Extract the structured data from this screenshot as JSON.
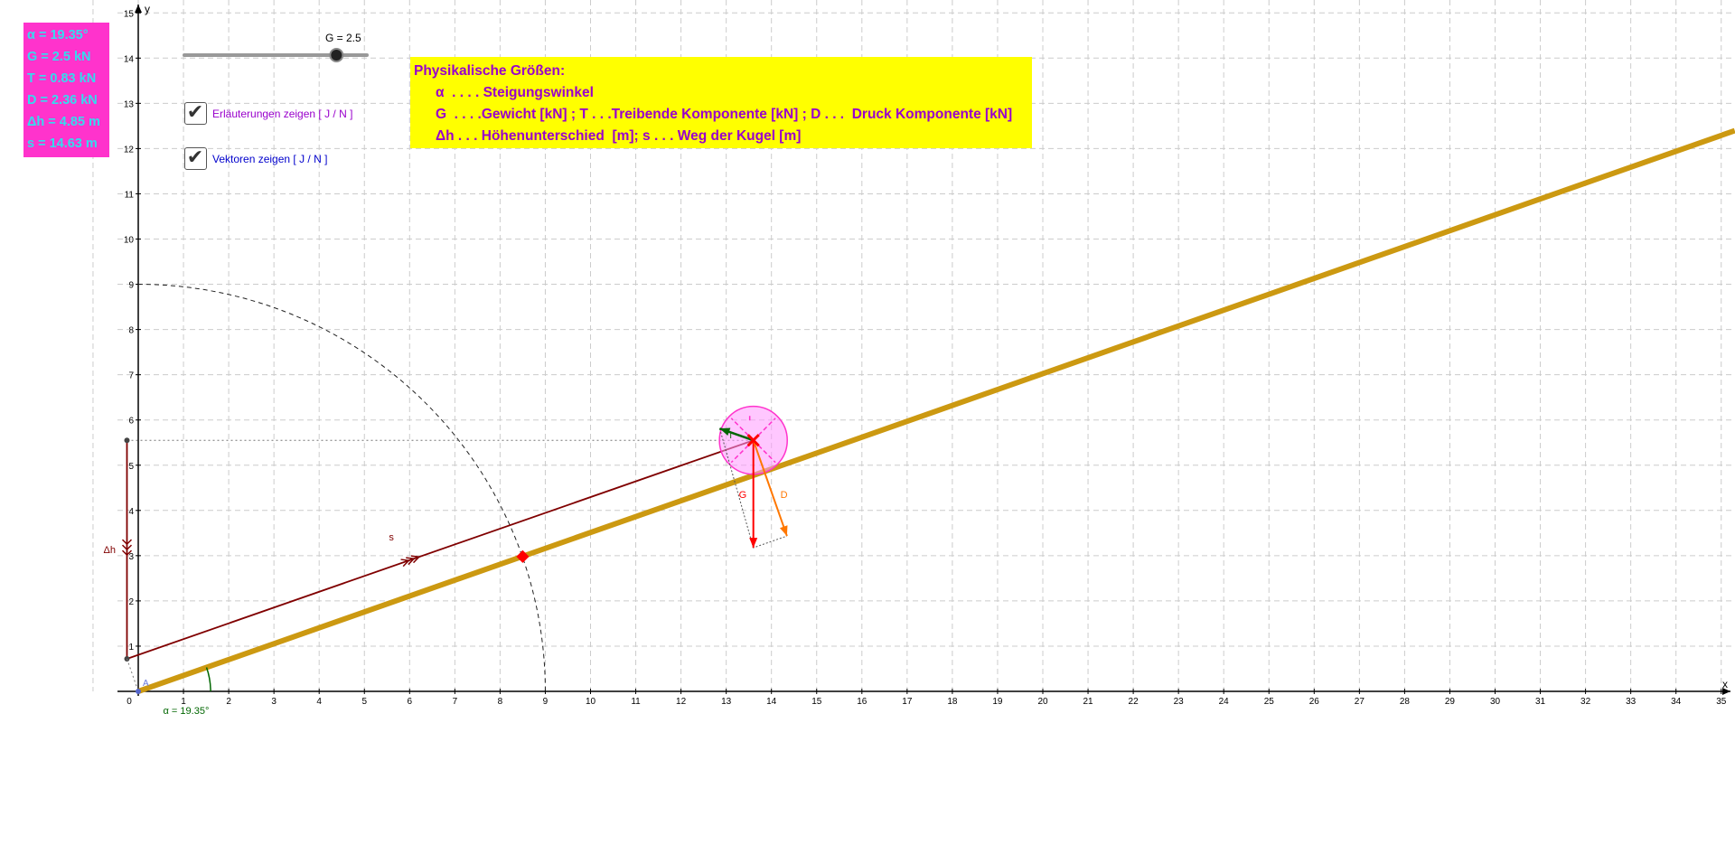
{
  "info": {
    "alpha": "α = 19.35°",
    "g": "G = 2.5 kN",
    "t": "T = 0.83 kN",
    "d": "D = 2.36 kN",
    "dh": "Δh = 4.85 m",
    "s": "s = 14.63 m"
  },
  "slider": {
    "label": "G = 2.5",
    "value": 2.5,
    "min": 0,
    "max": 3
  },
  "checkboxes": {
    "explain": {
      "label": "Erläuterungen zeigen [ J / N ]",
      "checked": true,
      "color": "#9900cc"
    },
    "vectors": {
      "label": "Vektoren zeigen [ J / N ]",
      "checked": true,
      "color": "#0000cc"
    }
  },
  "legend": {
    "title": "Physikalische Größen:",
    "line1": "α  . . . . Steigungswinkel",
    "line2": "G  . . . .Gewicht [kN] ; T . . .Treibende Komponente [kN] ; D . . .  Druck Komponente [kN]",
    "line3": "Δh . . . Höhenunterschied  [m]; s . . . Weg der Kugel [m]"
  },
  "axes": {
    "x_label": "x",
    "y_label": "y",
    "x_range": [
      0,
      35
    ],
    "y_range": [
      0,
      15
    ],
    "origin_label": "0",
    "x_ticks": [
      "1",
      "2",
      "3",
      "4",
      "5",
      "6",
      "7",
      "8",
      "9",
      "10",
      "11",
      "12",
      "13",
      "14",
      "15",
      "16",
      "17",
      "18",
      "19",
      "20",
      "21",
      "22",
      "23",
      "24",
      "25",
      "26",
      "27",
      "28",
      "29",
      "30",
      "31",
      "32",
      "33",
      "34",
      "35"
    ],
    "y_ticks": [
      "1",
      "2",
      "3",
      "4",
      "5",
      "6",
      "7",
      "8",
      "9",
      "10",
      "11",
      "12",
      "13",
      "14",
      "15"
    ],
    "grid": true
  },
  "geometry": {
    "angle_deg": 19.35,
    "ball_x": 13.6,
    "ball_y": 5.55,
    "ball_radius": 0.75,
    "arc_radius": 9,
    "intersection_x": 8.5,
    "intersection_y": 2.98,
    "s_start_y": 0.72,
    "ramp_end_x": 35.3,
    "dh_x": -0.25,
    "dh_top_y": 5.55,
    "dh_bottom_y": 0.72,
    "g_len": 2.5,
    "t_len": 0.83,
    "d_len": 2.36
  },
  "labels": {
    "s": "s",
    "dh": "Δh",
    "g": "G",
    "d": "D",
    "t": "T",
    "alpha": "α = 19.35°",
    "point_a": "A"
  },
  "colors": {
    "ramp": "#cc9911",
    "s_line": "#800000",
    "g_vec": "#ff0000",
    "d_vec": "#ff7700",
    "t_vec": "#006600",
    "ball_fill": "#ff99ff",
    "ball_edge": "#ff33cc",
    "angle": "#006600",
    "grid": "#cccccc",
    "point": "#ff0000"
  }
}
